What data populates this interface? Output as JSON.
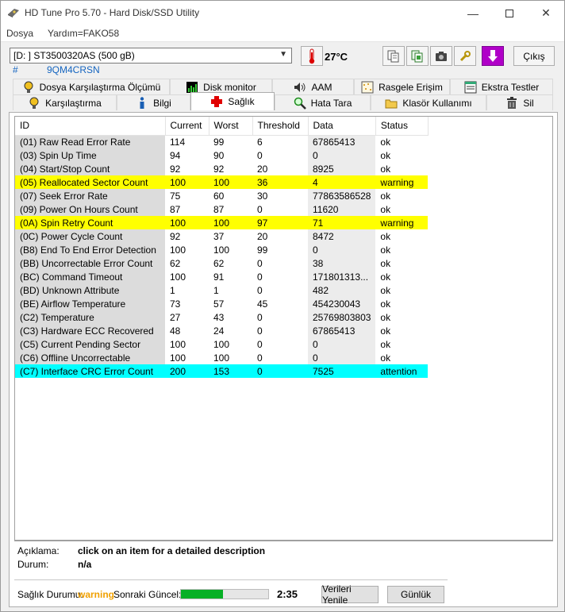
{
  "window": {
    "title": "HD Tune Pro 5.70 - Hard Disk/SSD Utility"
  },
  "menu": {
    "items": [
      "Dosya",
      "Yardım=FAKO58"
    ]
  },
  "toolbar": {
    "drive": "[D: ] ST3500320AS (500 gB)",
    "serial_hash": "#",
    "serial": "9QM4CRSN",
    "temperature": "27°C",
    "exit_label": "Çıkış"
  },
  "tabs_top": [
    "Dosya Karşılaştırma Ölçümü",
    "Disk monitor",
    "AAM",
    "Rasgele Erişim",
    "Ekstra Testler"
  ],
  "tabs_bottom": [
    "Karşılaştırma",
    "Bilgi",
    "Sağlık",
    "Hata Tara",
    "Klasör Kullanımı",
    "Sil"
  ],
  "active_tab": "Sağlık",
  "columns": [
    "ID",
    "Current",
    "Worst",
    "Threshold",
    "Data",
    "Status"
  ],
  "rows": [
    [
      "(01) Raw Read Error Rate",
      "114",
      "99",
      "6",
      "67865413",
      "ok"
    ],
    [
      "(03) Spin Up Time",
      "94",
      "90",
      "0",
      "0",
      "ok"
    ],
    [
      "(04) Start/Stop Count",
      "92",
      "92",
      "20",
      "8925",
      "ok"
    ],
    [
      "(05) Reallocated Sector Count",
      "100",
      "100",
      "36",
      "4",
      "warning"
    ],
    [
      "(07) Seek Error Rate",
      "75",
      "60",
      "30",
      "77863586528",
      "ok"
    ],
    [
      "(09) Power On Hours Count",
      "87",
      "87",
      "0",
      "11620",
      "ok"
    ],
    [
      "(0A) Spin Retry Count",
      "100",
      "100",
      "97",
      "71",
      "warning"
    ],
    [
      "(0C) Power Cycle Count",
      "92",
      "37",
      "20",
      "8472",
      "ok"
    ],
    [
      "(B8) End To End Error Detection",
      "100",
      "100",
      "99",
      "0",
      "ok"
    ],
    [
      "(BB) Uncorrectable Error Count",
      "62",
      "62",
      "0",
      "38",
      "ok"
    ],
    [
      "(BC) Command Timeout",
      "100",
      "91",
      "0",
      "171801313...",
      "ok"
    ],
    [
      "(BD) Unknown Attribute",
      "1",
      "1",
      "0",
      "482",
      "ok"
    ],
    [
      "(BE) Airflow Temperature",
      "73",
      "57",
      "45",
      "454230043",
      "ok"
    ],
    [
      "(C2) Temperature",
      "27",
      "43",
      "0",
      "25769803803",
      "ok"
    ],
    [
      "(C3) Hardware ECC Recovered",
      "48",
      "24",
      "0",
      "67865413",
      "ok"
    ],
    [
      "(C5) Current Pending Sector",
      "100",
      "100",
      "0",
      "0",
      "ok"
    ],
    [
      "(C6) Offline Uncorrectable",
      "100",
      "100",
      "0",
      "0",
      "ok"
    ],
    [
      "(C7) Interface CRC Error Count",
      "200",
      "153",
      "0",
      "7525",
      "attention"
    ]
  ],
  "highlight_colors": {
    "warning": "#ffff00",
    "attention": "#00ffff"
  },
  "description": {
    "label": "Açıklama:",
    "value": "click on an item for a detailed description",
    "status_label": "Durum:",
    "status_value": "n/a"
  },
  "footer": {
    "health_label": "Sağlık Durumu:",
    "health_value": "warning",
    "next_update_label": "Sonraki Güncel:",
    "progress_fraction": 0.48,
    "timer": "2:35",
    "refresh_button": "Verileri Yenile",
    "log_button": "Günlük"
  }
}
